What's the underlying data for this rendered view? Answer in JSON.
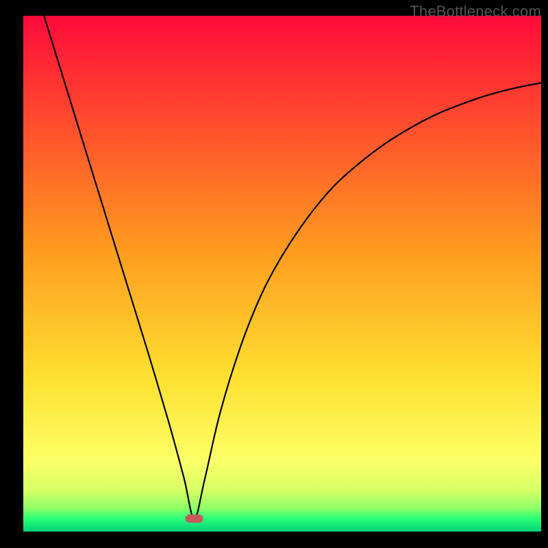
{
  "watermark": "TheBottleneck.com",
  "chart_data": {
    "type": "line",
    "title": "",
    "xlabel": "",
    "ylabel": "",
    "xlim": [
      0,
      100
    ],
    "ylim": [
      0,
      100
    ],
    "background_gradient": {
      "stops": [
        {
          "offset": 0.0,
          "color": "#ff0a3a"
        },
        {
          "offset": 0.45,
          "color": "#ff9a1f"
        },
        {
          "offset": 0.7,
          "color": "#ffe030"
        },
        {
          "offset": 0.86,
          "color": "#fdff66"
        },
        {
          "offset": 0.92,
          "color": "#d7ff66"
        },
        {
          "offset": 0.955,
          "color": "#8cff66"
        },
        {
          "offset": 0.975,
          "color": "#2aff77"
        },
        {
          "offset": 1.0,
          "color": "#00d07a"
        }
      ]
    },
    "minimum_marker": {
      "x": 33.0,
      "y": 2.5,
      "color": "#c55a5a"
    },
    "series": [
      {
        "name": "curve",
        "stroke": "#000000",
        "x": [
          4.0,
          8.0,
          12.0,
          16.0,
          20.0,
          24.0,
          28.0,
          31.0,
          33.0,
          35.0,
          38.0,
          42.0,
          46.0,
          50.0,
          55.0,
          60.0,
          65.0,
          70.0,
          75.0,
          80.0,
          85.0,
          90.0,
          95.0,
          100.0
        ],
        "values": [
          100.0,
          87.0,
          74.0,
          61.0,
          48.0,
          35.0,
          21.5,
          10.5,
          2.5,
          10.0,
          23.0,
          36.0,
          46.0,
          53.5,
          61.0,
          67.0,
          71.5,
          75.3,
          78.4,
          81.0,
          83.0,
          84.7,
          86.0,
          87.0
        ]
      }
    ]
  }
}
